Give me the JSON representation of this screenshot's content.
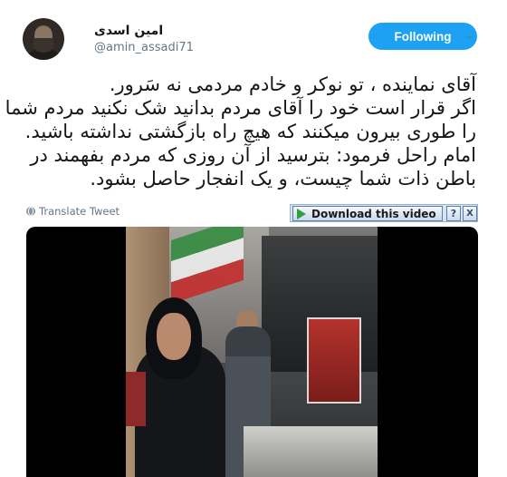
{
  "tweet": {
    "display_name": "امین اسدی",
    "username": "@amin_assadi71",
    "follow_label": "Following",
    "lines": [
      "آقای نماینده ، تو نوکر و خادم مردمی نه سَرور.",
      "اگر قرار است خود را آقای مردم بدانید شک نکنید مردم شما",
      "را طوری بیرون میکنند که هیچ راه بازگشتی نداشته باشید.",
      "امام راحل فرمود: بترسید از آن روزی که مردم بفهمند در",
      "باطن ذات شما چیست، و یک انفجار حاصل بشود."
    ],
    "translate_label": "Translate Tweet"
  },
  "extension": {
    "download_label": "Download this video",
    "help_label": "?",
    "close_label": "X"
  },
  "icons": {
    "avatar": "avatar",
    "chevron": "chevron-down-icon",
    "globe": "globe-icon",
    "play": "play-icon"
  },
  "colors": {
    "accent": "#1da1f2",
    "text": "#14171a",
    "muted": "#657786"
  }
}
